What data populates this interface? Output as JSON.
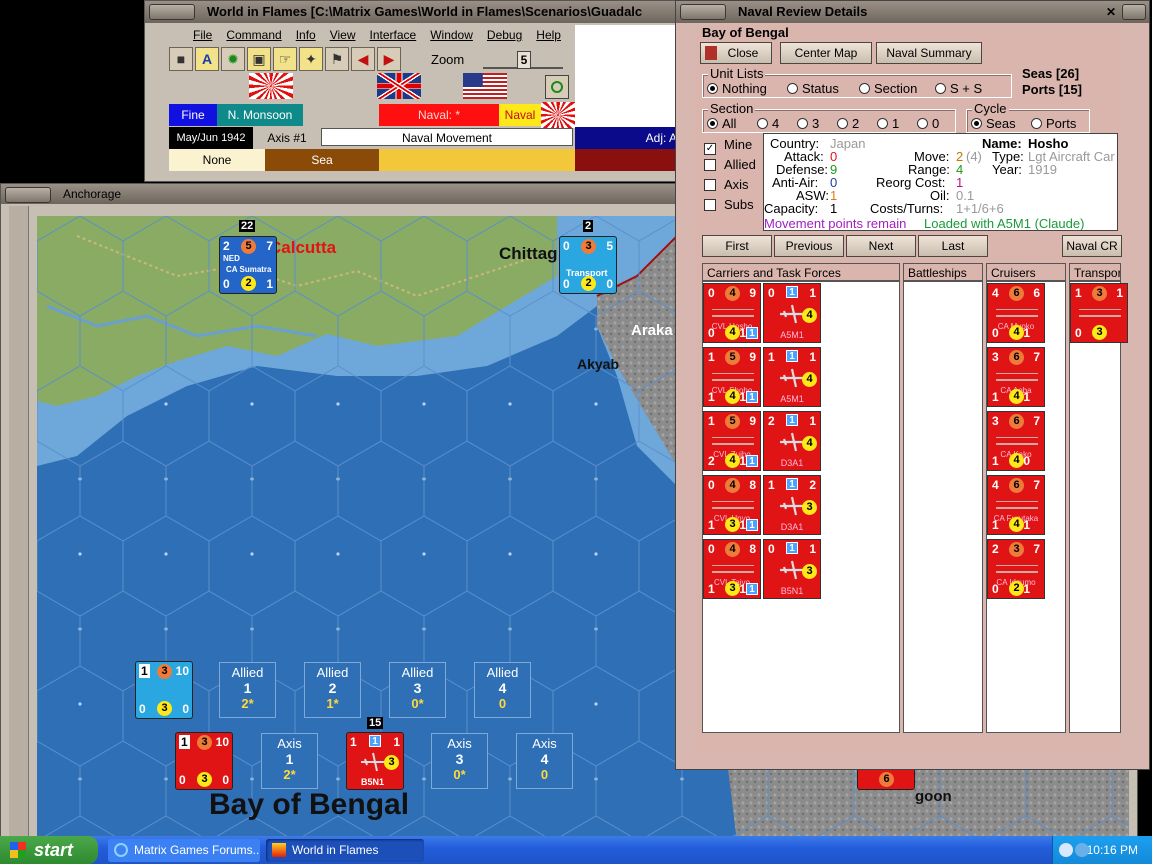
{
  "main_window": {
    "title": "World in Flames [C:\\Matrix Games\\World in Flames\\Scenarios\\Guadalc",
    "menu": [
      "File",
      "Command",
      "Info",
      "View",
      "Interface",
      "Window",
      "Debug",
      "Help"
    ],
    "zoom_label": "Zoom",
    "zoom_value": "5",
    "weather": "Fine",
    "monsoon": "N. Monsoon",
    "naval_star": "Naval: *",
    "naval": "Naval",
    "date": "May/Jun 1942",
    "impulse": "Axis #1",
    "phase": "Naval Movement",
    "adj": "Adj: Ar",
    "terrain1": "None",
    "terrain2": "Sea"
  },
  "map_window": {
    "title": "Anchorage",
    "labels": {
      "calcutta": "Calcutta",
      "chittagong": "Chittag",
      "akyab": "Akyab",
      "arakan": "Araka",
      "rangoon": "goon",
      "bay": "Bay of Bengal"
    },
    "counters": {
      "sumatra": {
        "top_left": "2",
        "attack": "5",
        "top_right": "7",
        "nat": "NED",
        "name": "CA Sumatra",
        "bot_left": "0",
        "def": "2",
        "bot_right": "1",
        "stack": "22"
      },
      "transport": {
        "top_left": "0",
        "attack": "3",
        "top_right": "5",
        "name": "Transport",
        "bot_left": "0",
        "def": "2",
        "bot_right": "0",
        "stack": "2"
      },
      "allied_box_unit": {
        "tl": "1",
        "att": "3",
        "tr": "10",
        "bl": "0",
        "def": "3",
        "br": "0"
      },
      "axis_box_unit": {
        "tl": "1",
        "att": "3",
        "tr": "10",
        "bl": "0",
        "def": "3",
        "br": "0"
      },
      "b5n1": {
        "tl": "1",
        "sq": "1",
        "tr": "1",
        "def": "3",
        "name": "B5N1",
        "stack": "15"
      },
      "rangoon_unit": {
        "def": "6"
      }
    },
    "sea_boxes_allied": [
      {
        "label": "Allied",
        "num": "1",
        "sub": "2*"
      },
      {
        "label": "Allied",
        "num": "2",
        "sub": "1*"
      },
      {
        "label": "Allied",
        "num": "3",
        "sub": "0*"
      },
      {
        "label": "Allied",
        "num": "4",
        "sub": "0"
      }
    ],
    "sea_boxes_axis": [
      {
        "label": "Axis",
        "num": "1",
        "sub": "2*"
      },
      {
        "label": "Axis",
        "num": "3",
        "sub": "0*"
      },
      {
        "label": "Axis",
        "num": "4",
        "sub": "0"
      }
    ]
  },
  "naval_window": {
    "title": "Naval Review Details",
    "location": "Bay of Bengal",
    "buttons": {
      "close": "Close",
      "center_map": "Center Map",
      "naval_summary": "Naval Summary"
    },
    "unit_lists": {
      "title": "Unit Lists",
      "options": [
        "Nothing",
        "Status",
        "Section",
        "S + S"
      ],
      "selected": "Nothing"
    },
    "seas_count": "Seas [26]",
    "ports_count": "Ports [15]",
    "section": {
      "title": "Section",
      "options": [
        "All",
        "4",
        "3",
        "2",
        "1",
        "0"
      ],
      "selected": "All"
    },
    "cycle": {
      "title": "Cycle",
      "options": [
        "Seas",
        "Ports"
      ],
      "selected": "Seas"
    },
    "filters": [
      {
        "label": "Mine",
        "checked": true
      },
      {
        "label": "Allied",
        "checked": false
      },
      {
        "label": "Axis",
        "checked": false
      },
      {
        "label": "Subs",
        "checked": false
      }
    ],
    "unit_info": {
      "country_label": "Country:",
      "country": "Japan",
      "name_label": "Name:",
      "name": "Hosho",
      "attack_label": "Attack:",
      "attack": "0",
      "move_label": "Move:",
      "move": "2",
      "move_extra": "(4)",
      "type_label": "Type:",
      "type": "Lgt Aircraft Car",
      "defense_label": "Defense:",
      "defense": "9",
      "range_label": "Range:",
      "range": "4",
      "year_label": "Year:",
      "year": "1919",
      "antiair_label": "Anti-Air:",
      "antiair": "0",
      "reorg_label": "Reorg Cost:",
      "reorg": "1",
      "asw_label": "ASW:",
      "asw": "1",
      "oil_label": "Oil:",
      "oil": "0.1",
      "capacity_label": "Capacity:",
      "capacity": "1",
      "costs_label": "Costs/Turns:",
      "costs": "1+1/6+6",
      "movement_status": "Movement points remain",
      "loaded": "Loaded with A5M1 (Claude)"
    },
    "nav": {
      "first": "First",
      "previous": "Previous",
      "next": "Next",
      "last": "Last",
      "naval_cr": "Naval CR"
    },
    "columns": [
      "Carriers and Task Forces",
      "Battleships",
      "Cruisers",
      "Transport"
    ],
    "carriers": [
      {
        "tl": "0",
        "att": "4",
        "tr": "9",
        "name": "CVL Hosho",
        "bl": "0",
        "def": "4",
        "br": "1"
      },
      {
        "tl": "1",
        "att": "5",
        "tr": "9",
        "name": "CVL Shoho",
        "bl": "1",
        "def": "4",
        "br": "1"
      },
      {
        "tl": "1",
        "att": "5",
        "tr": "9",
        "name": "CVL Zuiho",
        "bl": "2",
        "def": "4",
        "br": "1"
      },
      {
        "tl": "0",
        "att": "4",
        "tr": "8",
        "name": "CVL Unyo",
        "bl": "1",
        "def": "3",
        "br": "1"
      },
      {
        "tl": "0",
        "att": "4",
        "tr": "8",
        "name": "CVL Taiyo",
        "bl": "1",
        "def": "3",
        "br": "1"
      }
    ],
    "aircraft": [
      {
        "tl": "0",
        "sq": "1",
        "tr": "1",
        "def": "4",
        "name": "A5M1"
      },
      {
        "tl": "1",
        "sq": "1",
        "tr": "1",
        "def": "4",
        "name": "A5M1"
      },
      {
        "tl": "2",
        "sq": "1",
        "tr": "1",
        "def": "4",
        "name": "D3A1"
      },
      {
        "tl": "1",
        "sq": "1",
        "tr": "2",
        "def": "3",
        "name": "D3A1"
      },
      {
        "tl": "0",
        "sq": "1",
        "tr": "1",
        "def": "3",
        "name": "B5N1"
      }
    ],
    "cruisers": [
      {
        "tl": "4",
        "att": "6",
        "tr": "6",
        "name": "CA Myoko",
        "bl": "0",
        "def": "4",
        "br": "1"
      },
      {
        "tl": "3",
        "att": "6",
        "tr": "7",
        "name": "CA Aoba",
        "bl": "1",
        "def": "4",
        "br": "1"
      },
      {
        "tl": "3",
        "att": "6",
        "tr": "7",
        "name": "CA Kako",
        "bl": "1",
        "def": "4",
        "br": "0"
      },
      {
        "tl": "4",
        "att": "6",
        "tr": "7",
        "name": "CA Furutaka",
        "bl": "1",
        "def": "4",
        "br": "1"
      },
      {
        "tl": "2",
        "att": "3",
        "tr": "7",
        "name": "CA Idzumo",
        "bl": "0",
        "def": "2",
        "br": "1"
      }
    ],
    "transports": [
      {
        "tl": "1",
        "att": "3",
        "tr": "1",
        "bl": "0",
        "def": "3"
      }
    ]
  },
  "taskbar": {
    "start": "start",
    "tasks": [
      "Matrix Games Forums...",
      "World in Flames"
    ],
    "clock": "10:16 PM"
  },
  "colors": {
    "sea": "#2e6fb5",
    "axis_red": "#e01414",
    "allied_blue": "#2aa7e0",
    "window_pink": "#d9b5ae",
    "taskbar_blue": "#245edc"
  }
}
